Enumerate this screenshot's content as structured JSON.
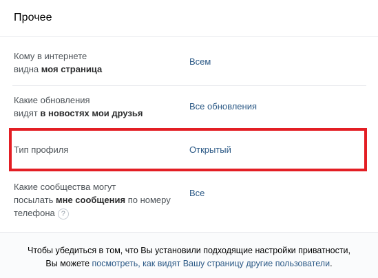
{
  "section": {
    "title": "Прочее"
  },
  "settings": [
    {
      "label_line1": "Кому в интернете",
      "label_line2_plain": "видна ",
      "label_line2_bold": "моя страница",
      "value": "Всем"
    },
    {
      "label_line1": "Какие обновления",
      "label_line2_plain": "видят ",
      "label_line2_bold": "в новостях мои друзья",
      "value": "Все обновления"
    },
    {
      "label": "Тип профиля",
      "value": "Открытый"
    },
    {
      "label_line1": "Какие сообщества могут",
      "label_line2_plain": "посылать ",
      "label_line2_bold": "мне сообщения",
      "label_line2_tail": " по номеру",
      "label_line3": "телефона",
      "help_icon": "?",
      "value": "Все"
    }
  ],
  "footer": {
    "text_line1": "Чтобы убедиться в том, что Вы установили подходящие настройки приватности,",
    "text_line2_prefix": "Вы можете ",
    "link": "посмотреть, как видят Вашу страницу другие пользователи",
    "text_line2_suffix": "."
  },
  "colors": {
    "link": "#2a5885",
    "highlight": "#e31e24",
    "separator": "#e7e8ec"
  }
}
